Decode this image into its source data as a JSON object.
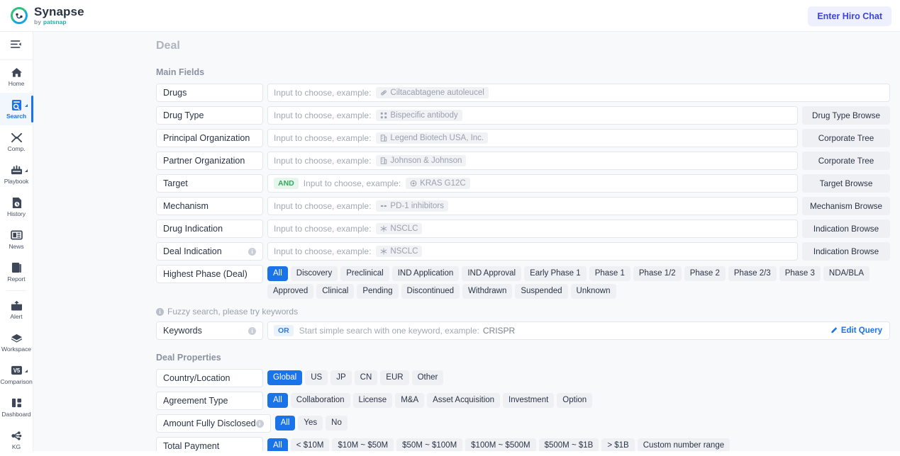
{
  "brand": {
    "name": "Synapse",
    "by": "by",
    "company": "patsnap",
    "logo_icon": "synapse-logo-icon"
  },
  "topbar": {
    "hiro_button": "Enter Hiro Chat"
  },
  "sidebar": {
    "collapse_icon": "collapse-menu-icon",
    "items": [
      {
        "label": "Home",
        "icon": "home-icon",
        "active": false,
        "caret": false
      },
      {
        "label": "Search",
        "icon": "search-document-icon",
        "active": true,
        "caret": true
      },
      {
        "label": "Comp.",
        "icon": "compare-icon",
        "active": false,
        "caret": false
      },
      {
        "label": "Playbook",
        "icon": "playbook-icon",
        "active": false,
        "caret": true
      },
      {
        "label": "History",
        "icon": "history-icon",
        "active": false,
        "caret": false
      },
      {
        "label": "News",
        "icon": "news-icon",
        "active": false,
        "caret": false
      },
      {
        "label": "Report",
        "icon": "report-icon",
        "active": false,
        "caret": false
      },
      {
        "label": "Alert",
        "icon": "alert-inbox-icon",
        "active": false,
        "caret": false
      },
      {
        "label": "Workspace",
        "icon": "workspace-cube-icon",
        "active": false,
        "caret": false
      },
      {
        "label": "Comparison",
        "icon": "v5-comparison-icon",
        "active": false,
        "caret": true
      },
      {
        "label": "Dashboard",
        "icon": "dashboard-grid-icon",
        "active": false,
        "caret": false
      },
      {
        "label": "KG",
        "icon": "knowledge-graph-icon",
        "active": false,
        "caret": false
      }
    ]
  },
  "page": {
    "title": "Deal"
  },
  "main_fields": {
    "heading": "Main Fields",
    "input_prefix": "Input to choose, example:",
    "rows": [
      {
        "label": "Drugs",
        "info": false,
        "placeholder": "Input to choose, example:",
        "example": "Ciltacabtagene autoleucel",
        "example_icon": "capsule-icon",
        "browse": null,
        "operator": null
      },
      {
        "label": "Drug Type",
        "info": false,
        "placeholder": "Input to choose, example:",
        "example": "Bispecific antibody",
        "example_icon": "molecule-icon",
        "browse": "Drug Type Browse",
        "operator": null
      },
      {
        "label": "Principal Organization",
        "info": false,
        "placeholder": "Input to choose, example:",
        "example": "Legend Biotech USA, Inc.",
        "example_icon": "building-icon",
        "browse": "Corporate Tree",
        "operator": null
      },
      {
        "label": "Partner Organization",
        "info": false,
        "placeholder": "Input to choose, example:",
        "example": "Johnson & Johnson",
        "example_icon": "building-icon",
        "browse": "Corporate Tree",
        "operator": null
      },
      {
        "label": "Target",
        "info": false,
        "placeholder": "Input to choose, example:",
        "example": "KRAS G12C",
        "example_icon": "target-icon",
        "browse": "Target Browse",
        "operator": "AND"
      },
      {
        "label": "Mechanism",
        "info": false,
        "placeholder": "Input to choose, example:",
        "example": "PD-1 inhibitors",
        "example_icon": "mechanism-icon",
        "browse": "Mechanism Browse",
        "operator": null
      },
      {
        "label": "Drug Indication",
        "info": false,
        "placeholder": "Input to choose, example:",
        "example": "NSCLC",
        "example_icon": "indication-icon",
        "browse": "Indication Browse",
        "operator": null
      },
      {
        "label": "Deal Indication",
        "info": true,
        "placeholder": "Input to choose, example:",
        "example": "NSCLC",
        "example_icon": "indication-icon",
        "browse": "Indication Browse",
        "operator": null
      }
    ],
    "highest_phase": {
      "label": "Highest Phase (Deal)",
      "options": [
        "All",
        "Discovery",
        "Preclinical",
        "IND Application",
        "IND Approval",
        "Early Phase 1",
        "Phase 1",
        "Phase 1/2",
        "Phase 2",
        "Phase 2/3",
        "Phase 3",
        "NDA/BLA",
        "Approved",
        "Clinical",
        "Pending",
        "Discontinued",
        "Withdrawn",
        "Suspended",
        "Unknown"
      ],
      "selected": "All"
    },
    "fuzzy_note": "Fuzzy search, please try keywords",
    "keywords": {
      "label": "Keywords",
      "info": true,
      "operator": "OR",
      "placeholder": "Start simple search with one keyword, example:",
      "example": "CRISPR",
      "edit_query": "Edit Query",
      "edit_icon": "pencil-icon"
    }
  },
  "deal_properties": {
    "heading": "Deal Properties",
    "rows": [
      {
        "label": "Country/Location",
        "info": false,
        "options": [
          "Global",
          "US",
          "JP",
          "CN",
          "EUR",
          "Other"
        ],
        "selected": "Global"
      },
      {
        "label": "Agreement Type",
        "info": false,
        "options": [
          "All",
          "Collaboration",
          "License",
          "M&A",
          "Asset Acquisition",
          "Investment",
          "Option"
        ],
        "selected": "All"
      },
      {
        "label": "Amount Fully Disclosed",
        "info": true,
        "options": [
          "All",
          "Yes",
          "No"
        ],
        "selected": "All"
      },
      {
        "label": "Total Payment",
        "info": false,
        "options": [
          "All",
          "< $10M",
          "$10M ~ $50M",
          "$50M ~ $100M",
          "$100M ~ $500M",
          "$500M ~ $1B",
          "> $1B",
          "Custom number range"
        ],
        "selected": "All"
      }
    ]
  },
  "colors": {
    "accent": "#1a73e8",
    "hiro": "#3b45e0",
    "and_badge": "#37a65c",
    "chip_bg": "#eef0f4",
    "page_bg": "#f8f9fb"
  }
}
